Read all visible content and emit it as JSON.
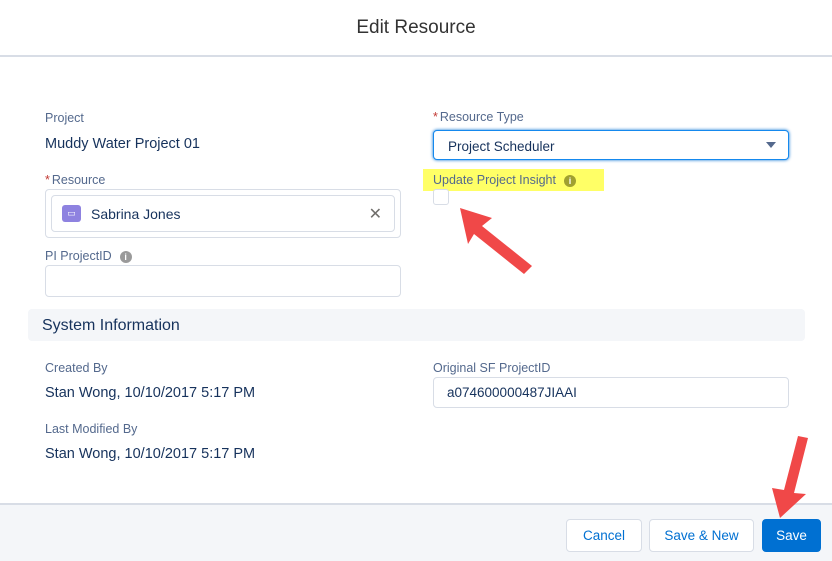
{
  "header": {
    "title": "Edit Resource"
  },
  "form": {
    "project": {
      "label": "Project",
      "value": "Muddy Water Project 01"
    },
    "resource_type": {
      "label": "Resource Type",
      "value": "Project Scheduler"
    },
    "resource": {
      "label": "Resource",
      "value": "Sabrina Jones"
    },
    "update_pi": {
      "label": "Update Project Insight",
      "checked": false
    },
    "pi_projectid": {
      "label": "PI ProjectID",
      "value": ""
    }
  },
  "system": {
    "title": "System Information",
    "created_by": {
      "label": "Created By",
      "value": "Stan Wong, 10/10/2017 5:17 PM"
    },
    "original_sf": {
      "label": "Original SF ProjectID",
      "value": "a074600000487JIAAI"
    },
    "modified_by": {
      "label": "Last Modified By",
      "value": "Stan Wong, 10/10/2017 5:17 PM"
    }
  },
  "footer": {
    "cancel": "Cancel",
    "save_new": "Save & New",
    "save": "Save"
  },
  "colors": {
    "brand": "#0070d2",
    "highlight": "#ffff66",
    "arrow": "#f04848"
  }
}
